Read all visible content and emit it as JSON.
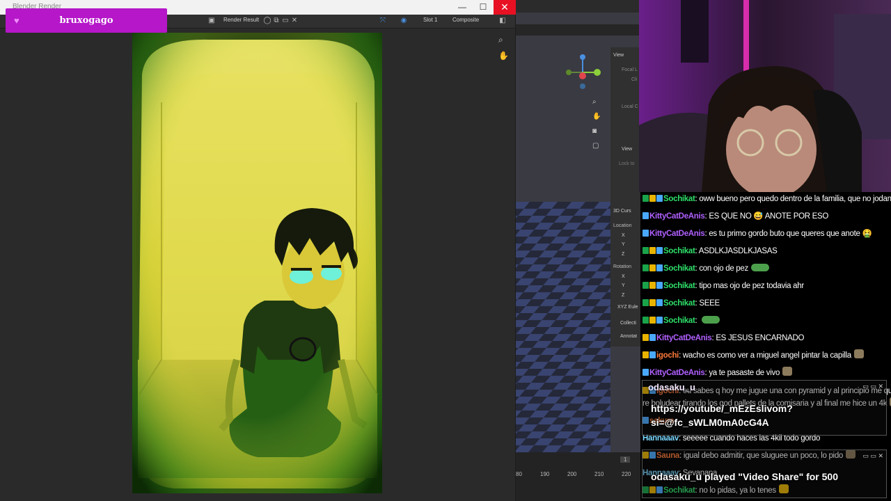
{
  "render_window": {
    "title": "Blender Render",
    "header": {
      "render_result": "Render Result",
      "slot": "Slot 1",
      "composite": "Composite"
    },
    "controls": {
      "minimize": "—",
      "maximize": "☐",
      "close": "✕"
    }
  },
  "banner": {
    "name": "bruxogago"
  },
  "viewport": {
    "npanel": {
      "view": "View",
      "focal": "Focal L",
      "clip": "Cli",
      "local": "Local C",
      "view2": "View",
      "lock": "Lock to",
      "cursor": "3D Curs",
      "location": "Location",
      "x": "X",
      "y": "Y",
      "z": "Z",
      "rotation": "Rotation",
      "xyz": "XYZ Eule",
      "collection": "Collecti",
      "annotations": "Annotat"
    },
    "timeline": {
      "frame": "1",
      "ticks": [
        "80",
        "190",
        "200",
        "210",
        "220"
      ]
    }
  },
  "chat": {
    "messages": [
      {
        "user": "Sochikat",
        "color": "#2ee06a",
        "text": "oww bueno pero quedo dentro de la familia, que no jodan alkjsdas"
      },
      {
        "user": "KittyCatDeAnis",
        "color": "#b060ff",
        "text": "ES QUE NO 😅 ANOTE POR ESO"
      },
      {
        "user": "KittyCatDeAnis",
        "color": "#b060ff",
        "text": "es tu primo gordo buto que queres que anote 🤮"
      },
      {
        "user": "Sochikat",
        "color": "#2ee06a",
        "text": "ASDLKJASDLKJASAS"
      },
      {
        "user": "Sochikat",
        "color": "#2ee06a",
        "text": "con ojo de pez"
      },
      {
        "user": "Sochikat",
        "color": "#2ee06a",
        "text": "tipo mas ojo de pez todavia ahr"
      },
      {
        "user": "Sochikat",
        "color": "#2ee06a",
        "text": "SEEE"
      },
      {
        "user": "Sochikat",
        "color": "#2ee06a",
        "text": ""
      },
      {
        "user": "KittyCatDeAnis",
        "color": "#b060ff",
        "text": "ES JESUS ENCARNADO"
      },
      {
        "user": "igochi",
        "color": "#ff7a3a",
        "text": "wacho es como ver a miguel angel pintar la capilla"
      },
      {
        "user": "KittyCatDeAnis",
        "color": "#b060ff",
        "text": "ya te pasaste de vivo"
      },
      {
        "user": "igochi",
        "color": "#ff7a3a",
        "text": "eu sabes q hoy me jugue una con pyramid y al principio me quisieron"
      },
      {
        "user": "",
        "color": "#ffffff",
        "text": "re boludear tirando los god pallets de la comisaria y al final me hice un 4k"
      },
      {
        "user": "sakura",
        "color": "#ff7a3a",
        "text": ""
      },
      {
        "user": "Hannaaav",
        "color": "#7ad7ff",
        "text": "seeeee cuando haces las 4kil todo gordo"
      },
      {
        "user": "Sauna",
        "color": "#ff7a3a",
        "text": "igual debo admitir, que sluguee un poco, lo pido"
      },
      {
        "user": "Hannaaav",
        "color": "#7ad7ff",
        "text": "Sevanana"
      },
      {
        "user": "Sochikat",
        "color": "#2ee06a",
        "text": "no lo pidas, ya lo tenes"
      }
    ],
    "popup1": {
      "user": "odasaku_u",
      "line1": "https://youtube/_mEzEslivom?",
      "line2": "si=@fc_sWLM0mA0cG4A"
    },
    "popup2": {
      "user": "odasaku_u",
      "line1": "odasaku_u played \"Video Share\" for 500"
    }
  }
}
